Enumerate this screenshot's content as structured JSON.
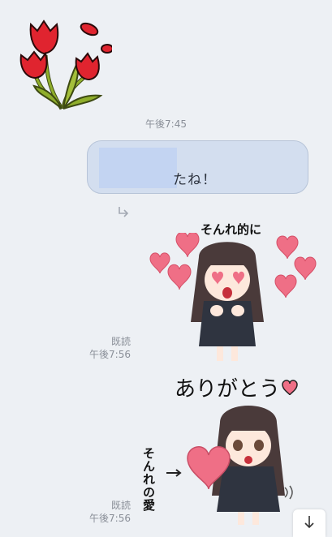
{
  "chat": {
    "center_timestamp": "午後7:45",
    "outgoing_bubble_text": "たね！",
    "sticker1": {
      "read_label": "既読",
      "time": "午後7:56",
      "caption": "そんれ的に"
    },
    "sticker2": {
      "read_label": "既読",
      "time": "午後7:56",
      "caption_top": "ありがとう",
      "caption_side": "そんれの愛"
    }
  },
  "icons": {
    "tulip": "tulip-sticker-icon",
    "reply_arrow": "reply-arrow-icon",
    "scroll_down": "scroll-down-icon"
  },
  "colors": {
    "background": "#edf0f4",
    "bubble": "#d3deef",
    "heart": "#ef6f86",
    "tulip_red": "#e0242f",
    "leaf_green": "#7f9a2a"
  }
}
